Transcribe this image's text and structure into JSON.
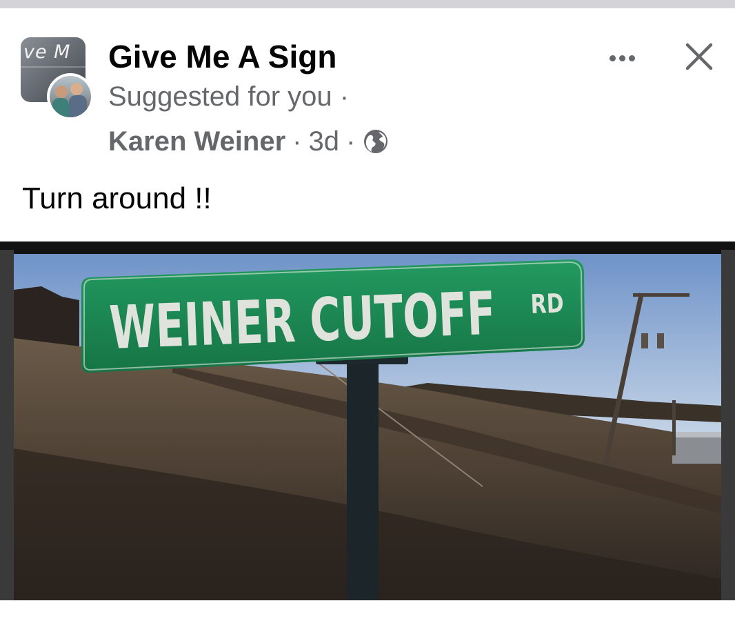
{
  "post": {
    "group_name": "Give Me A Sign",
    "group_avatar_text": "ve M",
    "suggested": "Suggested for you",
    "dot": "·",
    "author": "Karen Weiner",
    "time": "3d",
    "privacy_icon": "globe-icon",
    "text": "Turn around !!"
  },
  "photo": {
    "sign_main": "WEINER CUTOFF",
    "sign_suffix": "RD"
  },
  "actions": {
    "more_icon": "more-horizontal-icon",
    "close_icon": "close-icon"
  },
  "colors": {
    "secondary_text": "#65676b",
    "primary_text": "#050505",
    "sign_green": "#1f8a55"
  }
}
